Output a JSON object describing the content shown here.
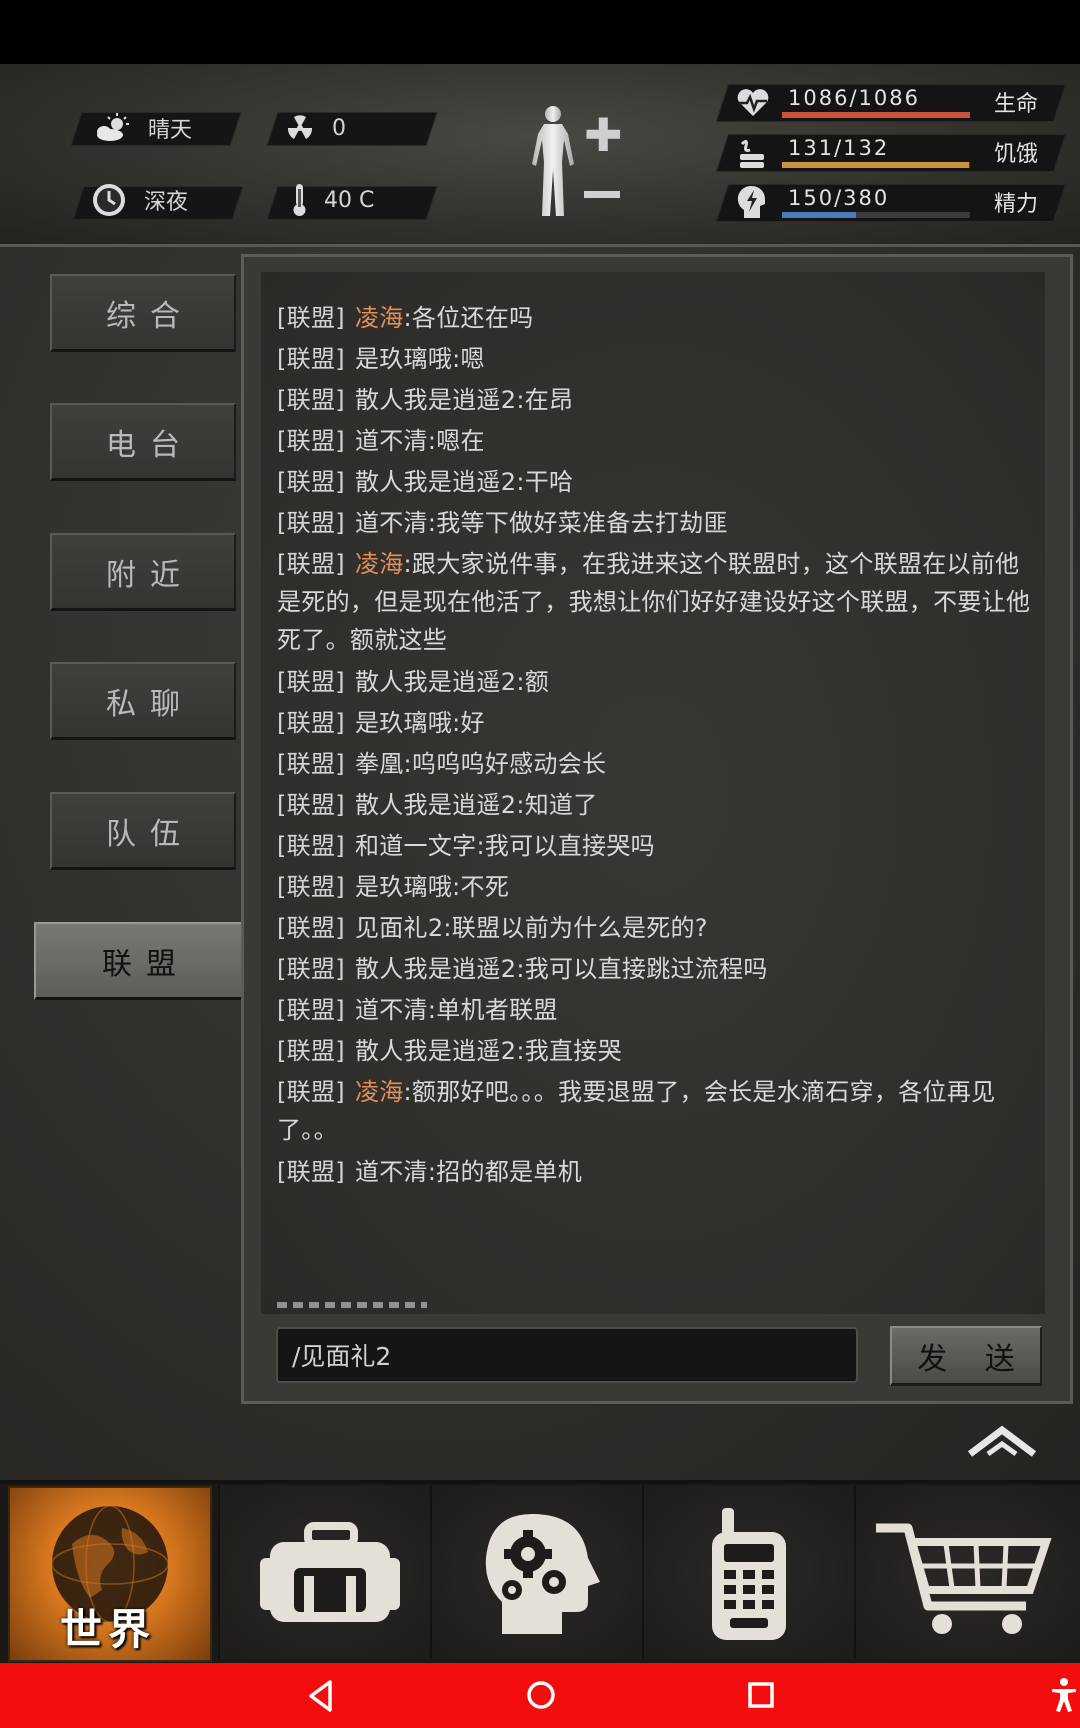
{
  "hud": {
    "weather": {
      "label": "晴天",
      "icon": "partly-cloudy-icon"
    },
    "radiation": {
      "value": "0",
      "icon": "radiation-icon"
    },
    "time": {
      "label": "深夜",
      "icon": "clock-icon"
    },
    "temperature": {
      "value": "40 C",
      "icon": "thermometer-icon"
    },
    "stats": [
      {
        "name": "生命",
        "value": "1086/1086",
        "current": 1086,
        "max": 1086,
        "color": "#c9533f",
        "icon": "heart-pulse-icon"
      },
      {
        "name": "饥饿",
        "value": "131/132",
        "current": 131,
        "max": 132,
        "color": "#c9923f",
        "icon": "food-icon"
      },
      {
        "name": "精力",
        "value": "150/380",
        "current": 150,
        "max": 380,
        "color": "#4a7cbb",
        "icon": "energy-head-icon"
      }
    ]
  },
  "tabs": [
    {
      "label": "综合",
      "active": false
    },
    {
      "label": "电台",
      "active": false
    },
    {
      "label": "附近",
      "active": false
    },
    {
      "label": "私聊",
      "active": false
    },
    {
      "label": "队伍",
      "active": false
    },
    {
      "label": "联盟",
      "active": true
    }
  ],
  "chat": {
    "messages": [
      {
        "tag": "[联盟]",
        "who": "凌海",
        "highlight": true,
        "text": ":各位还在吗"
      },
      {
        "tag": "[联盟]",
        "who": "是玖璃哦",
        "highlight": false,
        "text": ":嗯"
      },
      {
        "tag": "[联盟]",
        "who": "散人我是逍遥2",
        "highlight": false,
        "text": ":在昂"
      },
      {
        "tag": "[联盟]",
        "who": "道不清",
        "highlight": false,
        "text": ":嗯在"
      },
      {
        "tag": "[联盟]",
        "who": "散人我是逍遥2",
        "highlight": false,
        "text": ":干哈"
      },
      {
        "tag": "[联盟]",
        "who": "道不清",
        "highlight": false,
        "text": ":我等下做好菜准备去打劫匪"
      },
      {
        "tag": "[联盟]",
        "who": "凌海",
        "highlight": true,
        "text": ":跟大家说件事，在我进来这个联盟时，这个联盟在以前他是死的，但是现在他活了，我想让你们好好建设好这个联盟，不要让他死了。额就这些"
      },
      {
        "tag": "[联盟]",
        "who": "散人我是逍遥2",
        "highlight": false,
        "text": ":额"
      },
      {
        "tag": "[联盟]",
        "who": "是玖璃哦",
        "highlight": false,
        "text": ":好"
      },
      {
        "tag": "[联盟]",
        "who": "拳凰",
        "highlight": false,
        "text": ":呜呜呜好感动会长"
      },
      {
        "tag": "[联盟]",
        "who": "散人我是逍遥2",
        "highlight": false,
        "text": ":知道了"
      },
      {
        "tag": "[联盟]",
        "who": "和道一文字",
        "highlight": false,
        "text": ":我可以直接哭吗"
      },
      {
        "tag": "[联盟]",
        "who": "是玖璃哦",
        "highlight": false,
        "text": ":不死"
      },
      {
        "tag": "[联盟]",
        "who": "见面礼2",
        "highlight": false,
        "text": ":联盟以前为什么是死的?"
      },
      {
        "tag": "[联盟]",
        "who": "散人我是逍遥2",
        "highlight": false,
        "text": ":我可以直接跳过流程吗"
      },
      {
        "tag": "[联盟]",
        "who": "道不清",
        "highlight": false,
        "text": ":单机者联盟"
      },
      {
        "tag": "[联盟]",
        "who": "散人我是逍遥2",
        "highlight": false,
        "text": ":我直接哭"
      },
      {
        "tag": "[联盟]",
        "who": "凌海",
        "highlight": true,
        "text": ":额那好吧。。。我要退盟了，会长是水滴石穿，各位再见了。。"
      },
      {
        "tag": "[联盟]",
        "who": "道不清",
        "highlight": false,
        "text": ":招的都是单机"
      }
    ],
    "input_value": "/见面礼2",
    "send_label": "发 送"
  },
  "bottom_nav": {
    "world_label": "世界",
    "items": [
      "backpack-icon",
      "skills-head-gears-icon",
      "walkie-talkie-icon",
      "shopping-cart-icon"
    ]
  },
  "system_nav": [
    "back-icon",
    "home-icon",
    "recents-icon",
    "accessibility-icon"
  ],
  "colors": {
    "highlight_name": "#e0905a",
    "system_nav_bg": "#f40d0d"
  }
}
